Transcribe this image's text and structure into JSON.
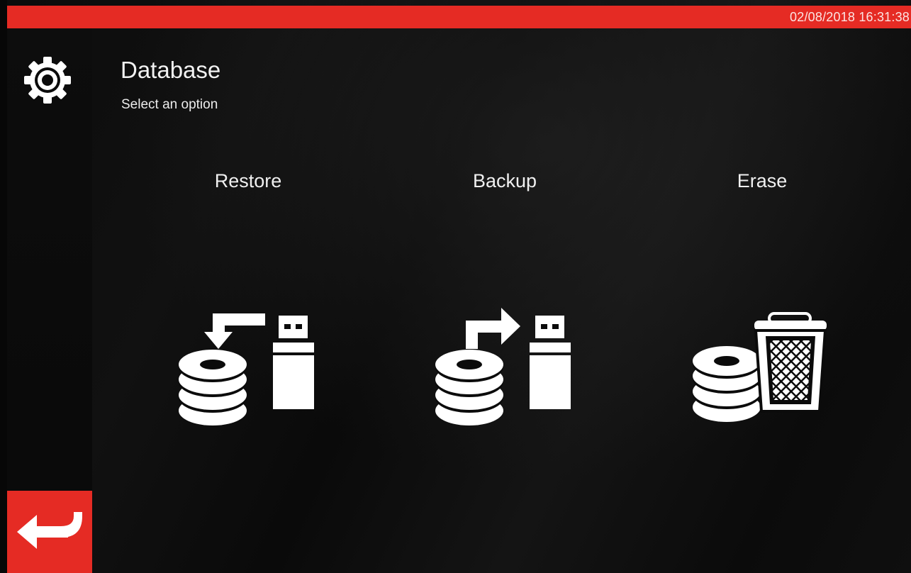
{
  "status_bar": {
    "datetime": "02/08/2018 16:31:38",
    "accent_color": "#e52b24"
  },
  "header": {
    "icon": "gear-icon",
    "title": "Database",
    "subtitle": "Select an option"
  },
  "options": [
    {
      "label": "Restore",
      "icon": "database-restore-from-usb-icon"
    },
    {
      "label": "Backup",
      "icon": "database-backup-to-usb-icon"
    },
    {
      "label": "Erase",
      "icon": "database-erase-icon"
    }
  ],
  "footer": {
    "back_icon": "return-arrow-icon"
  }
}
